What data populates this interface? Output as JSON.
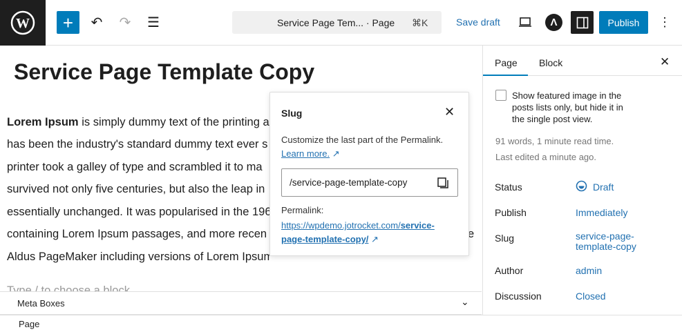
{
  "topbar": {
    "command_text": "Service Page Tem... · Page",
    "shortcut": "⌘K",
    "save_draft": "Save draft",
    "publish": "Publish",
    "accent": "#007cba"
  },
  "editor": {
    "title": "Service Page Template Copy",
    "para_bold": "Lorem Ipsum",
    "lines": [
      " is simply dummy text of the printing a",
      "has been the industry's standard dummy text ever s",
      "printer took a galley of type and scrambled it to ma",
      "survived not only five centuries, but also the leap in",
      "essentially unchanged. It was popularised in the 196",
      "containing Lorem Ipsum passages, and more recen",
      "Aldus PageMaker including versions of Lorem Ipsum"
    ],
    "line6_tail": "e",
    "placeholder": "Type / to choose a block"
  },
  "popover": {
    "title": "Slug",
    "description": "Customize the last part of the Permalink.",
    "learn_more": "Learn more.",
    "slug_value": "/service-page-template-copy",
    "permalink_label": "Permalink:",
    "permalink_base": "https://wpdemo.jotrocket.com/",
    "permalink_slug_1": "service-",
    "permalink_slug_2": "page-template-copy/"
  },
  "sidebar": {
    "tabs": [
      {
        "label": "Page",
        "active": true
      },
      {
        "label": "Block",
        "active": false
      }
    ],
    "checkbox_label_1": "Show featured image in the",
    "checkbox_label_2": "posts lists only, but hide it in",
    "checkbox_label_3": "the single post view.",
    "checkbox_checked": false,
    "words": "91 words, 1 minute read time.",
    "last_edited": "Last edited a minute ago.",
    "rows": [
      {
        "label": "Status",
        "value": "Draft"
      },
      {
        "label": "Publish",
        "value": "Immediately"
      },
      {
        "label": "Slug",
        "value": "service-page-",
        "value2": "template-copy"
      },
      {
        "label": "Author",
        "value": "admin"
      },
      {
        "label": "Discussion",
        "value": "Closed"
      }
    ]
  },
  "meta_boxes": "Meta Boxes",
  "footer": {
    "breadcrumb": "Page"
  }
}
